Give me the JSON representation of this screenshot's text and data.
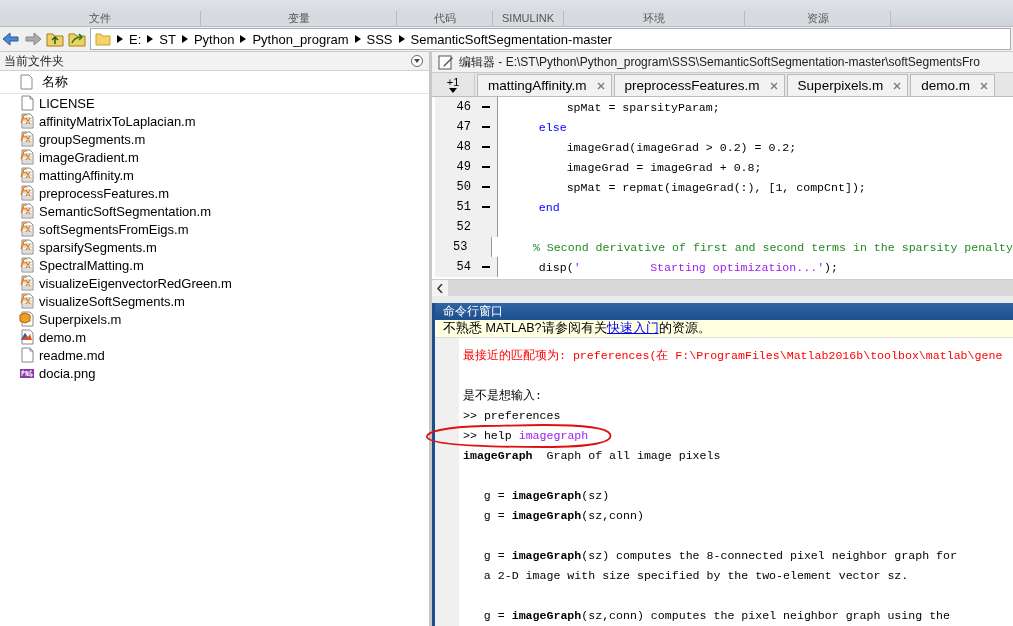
{
  "toolstrip": {
    "sections": [
      "文件",
      "变量",
      "代码",
      "SIMULINK",
      "环境",
      "资源"
    ]
  },
  "address_bar": {
    "path": [
      "E:",
      "ST",
      "Python",
      "Python_program",
      "SSS",
      "SemanticSoftSegmentation-master"
    ]
  },
  "file_browser": {
    "title": "当前文件夹",
    "column": "名称",
    "files": [
      {
        "name": "LICENSE",
        "kind": "text"
      },
      {
        "name": "affinityMatrixToLaplacian.m",
        "kind": "function"
      },
      {
        "name": "groupSegments.m",
        "kind": "function"
      },
      {
        "name": "imageGradient.m",
        "kind": "function"
      },
      {
        "name": "mattingAffinity.m",
        "kind": "function"
      },
      {
        "name": "preprocessFeatures.m",
        "kind": "function"
      },
      {
        "name": "SemanticSoftSegmentation.m",
        "kind": "function"
      },
      {
        "name": "softSegmentsFromEigs.m",
        "kind": "function"
      },
      {
        "name": "sparsifySegments.m",
        "kind": "function"
      },
      {
        "name": "SpectralMatting.m",
        "kind": "function"
      },
      {
        "name": "visualizeEigenvectorRedGreen.m",
        "kind": "function"
      },
      {
        "name": "visualizeSoftSegments.m",
        "kind": "function"
      },
      {
        "name": "Superpixels.m",
        "kind": "class"
      },
      {
        "name": "demo.m",
        "kind": "script"
      },
      {
        "name": "readme.md",
        "kind": "text"
      },
      {
        "name": "docia.png",
        "kind": "image"
      }
    ]
  },
  "editor": {
    "title": "编辑器 - E:\\ST\\Python\\Python_program\\SSS\\SemanticSoftSegmentation-master\\softSegmentsFro",
    "tab_counter": "+1",
    "tabs": [
      {
        "label": "mattingAffinity.m",
        "selected": false
      },
      {
        "label": "preprocessFeatures.m",
        "selected": false
      },
      {
        "label": "Superpixels.m",
        "selected": false
      },
      {
        "label": "demo.m",
        "selected": false
      }
    ],
    "lines": [
      {
        "number": "46",
        "executable": true,
        "segments": [
          {
            "kind": "code",
            "text": "        spMat = sparsityParam;"
          }
        ]
      },
      {
        "number": "47",
        "executable": true,
        "segments": [
          {
            "kind": "keyword",
            "text": "    else"
          }
        ]
      },
      {
        "number": "48",
        "executable": true,
        "segments": [
          {
            "kind": "code",
            "text": "        imageGrad(imageGrad > 0.2) = 0.2;"
          }
        ]
      },
      {
        "number": "49",
        "executable": true,
        "segments": [
          {
            "kind": "code",
            "text": "        imageGrad = imageGrad + 0.8;"
          }
        ]
      },
      {
        "number": "50",
        "executable": true,
        "segments": [
          {
            "kind": "code",
            "text": "        spMat = repmat(imageGrad(:), [1, compCnt]);"
          }
        ]
      },
      {
        "number": "51",
        "executable": true,
        "segments": [
          {
            "kind": "keyword",
            "text": "    end"
          }
        ]
      },
      {
        "number": "52",
        "executable": false
      },
      {
        "number": "53",
        "executable": false,
        "segments": [
          {
            "kind": "comment",
            "text": "    % Second derivative of first and second terms in the sparsity penalty"
          }
        ]
      },
      {
        "number": "54",
        "executable": true,
        "segments": [
          {
            "kind": "code",
            "text": "    disp("
          },
          {
            "kind": "string",
            "text": "'          Starting optimization...'"
          },
          {
            "kind": "code",
            "text": ");"
          }
        ]
      }
    ]
  },
  "command_window": {
    "title": "命令行窗口",
    "notice": {
      "before": "不熟悉 MATLAB?请参阅有关",
      "link": "快速入门",
      "after": "的资源。"
    },
    "lines": [
      {
        "kind": "error",
        "text": "最接近的匹配项为: preferences(在 F:\\ProgramFiles\\Matlab2016b\\toolbox\\matlab\\gene"
      },
      {
        "kind": "blank"
      },
      {
        "kind": "plain",
        "text": "是不是想输入:"
      },
      {
        "kind": "prompt",
        "prompt": ">>",
        "text": "preferences"
      },
      {
        "kind": "prompt",
        "prompt": ">>",
        "text": "help",
        "argument": "imagegraph"
      },
      {
        "kind": "help",
        "text": "**imageGraph**  Graph of all image pixels"
      },
      {
        "kind": "blank"
      },
      {
        "kind": "help",
        "text": "   g = **imageGraph**(sz)"
      },
      {
        "kind": "help",
        "text": "   g = **imageGraph**(sz,conn)"
      },
      {
        "kind": "blank"
      },
      {
        "kind": "help",
        "text": "   g = **imageGraph**(sz) computes the 8-connected pixel neighbor graph for"
      },
      {
        "kind": "help",
        "text": "   a 2-D image with size specified by the two-element vector sz."
      },
      {
        "kind": "blank"
      },
      {
        "kind": "help",
        "text": "   g = **imageGraph**(sz,conn) computes the pixel neighbor graph using the"
      }
    ]
  }
}
